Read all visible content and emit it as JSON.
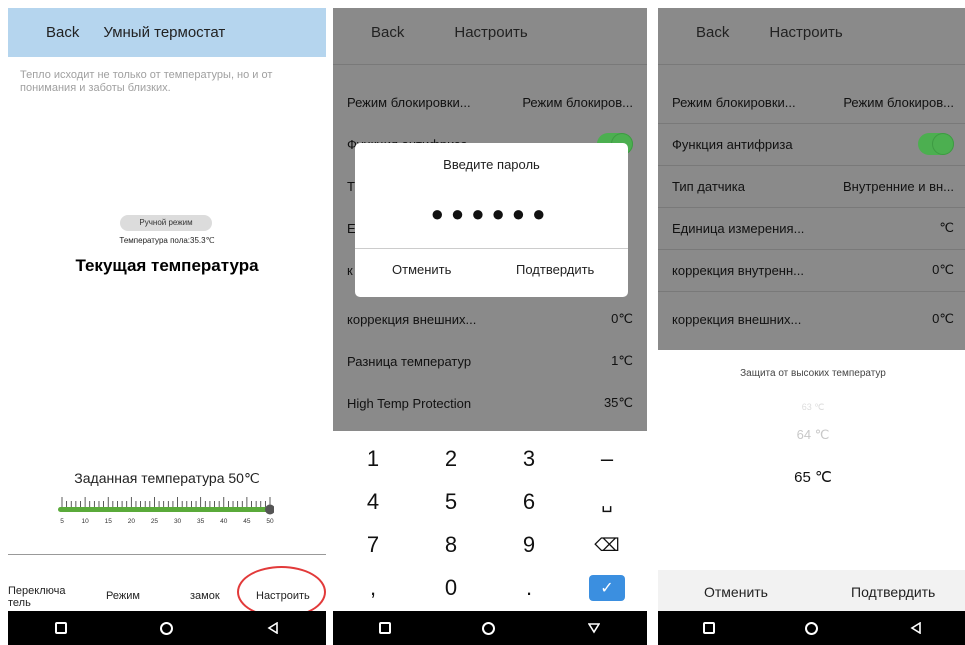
{
  "panel1": {
    "back": "Back",
    "title": "Умный термостат",
    "quote": "Тепло исходит не только от температуры, но и от понимания и заботы близких.",
    "mode_badge": "Ручной режим",
    "floor_temp": "Температура пола:35.3℃",
    "current_temp_label": "Текущая температура",
    "set_temp": "Заданная температура 50℃",
    "slider_ticks": [
      "5",
      "10",
      "15",
      "20",
      "25",
      "30",
      "35",
      "40",
      "45",
      "50"
    ],
    "slider_value_fraction": 1.0,
    "tabs": {
      "switch": "Переключатель",
      "mode": "Режим",
      "lock": "замок",
      "settings": "Настроить"
    }
  },
  "panel2": {
    "back": "Back",
    "title": "Настроить",
    "rows": [
      {
        "label": "Режим блокировки...",
        "value": "Режим блокиров..."
      },
      {
        "label": "Функция антифриза",
        "value": ""
      },
      {
        "label": "Т",
        "value": ""
      },
      {
        "label": "Е",
        "value": ""
      },
      {
        "label": "к",
        "value": ""
      },
      {
        "label": "коррекция внешних...",
        "value": "0℃"
      },
      {
        "label": "Разница температур",
        "value": "1℃"
      },
      {
        "label": "High Temp Protection",
        "value": "35℃"
      }
    ],
    "dialog": {
      "title": "Введите пароль",
      "dots": "●●●●●●",
      "cancel": "Отменить",
      "confirm": "Подтвердить"
    },
    "keys": [
      [
        "1",
        "2",
        "3",
        "–"
      ],
      [
        "4",
        "5",
        "6",
        "␣"
      ],
      [
        "7",
        "8",
        "9",
        "⌫"
      ],
      [
        ",",
        "0",
        ".",
        "✓"
      ]
    ]
  },
  "panel3": {
    "back": "Back",
    "title": "Настроить",
    "rows": [
      {
        "label": "Режим блокировки...",
        "value": "Режим блокиров..."
      },
      {
        "label": "Функция антифриза",
        "value": ""
      },
      {
        "label": "Тип датчика",
        "value": "Внутренние и вн..."
      },
      {
        "label": "Единица измерения...",
        "value": "℃"
      },
      {
        "label": "коррекция внутренн...",
        "value": "0℃"
      },
      {
        "label": "коррекция внешних...",
        "value": "0℃"
      }
    ],
    "sheet_title": "Защита от высоких температур",
    "wheel": {
      "faded_top": "63 ℃",
      "prev": "64 ℃",
      "selected": "65 ℃"
    },
    "cancel": "Отменить",
    "confirm": "Подтвердить"
  },
  "colors": {
    "header_blue": "#b5d5ee",
    "toggle_green": "#4caf50",
    "keypad_confirm": "#3b8fe0",
    "highlight_red": "#e23a3a",
    "slider_green": "#5aaa3a"
  },
  "icons": [
    "nav-square-icon",
    "nav-home-icon",
    "nav-back-icon",
    "backspace-icon",
    "check-icon",
    "space-icon"
  ]
}
